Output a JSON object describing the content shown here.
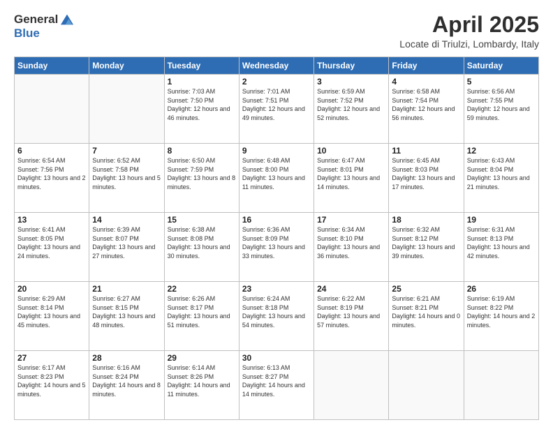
{
  "logo": {
    "general": "General",
    "blue": "Blue"
  },
  "title": "April 2025",
  "location": "Locate di Triulzi, Lombardy, Italy",
  "days_of_week": [
    "Sunday",
    "Monday",
    "Tuesday",
    "Wednesday",
    "Thursday",
    "Friday",
    "Saturday"
  ],
  "weeks": [
    [
      {
        "day": "",
        "sunrise": "",
        "sunset": "",
        "daylight": ""
      },
      {
        "day": "",
        "sunrise": "",
        "sunset": "",
        "daylight": ""
      },
      {
        "day": "1",
        "sunrise": "Sunrise: 7:03 AM",
        "sunset": "Sunset: 7:50 PM",
        "daylight": "Daylight: 12 hours and 46 minutes."
      },
      {
        "day": "2",
        "sunrise": "Sunrise: 7:01 AM",
        "sunset": "Sunset: 7:51 PM",
        "daylight": "Daylight: 12 hours and 49 minutes."
      },
      {
        "day": "3",
        "sunrise": "Sunrise: 6:59 AM",
        "sunset": "Sunset: 7:52 PM",
        "daylight": "Daylight: 12 hours and 52 minutes."
      },
      {
        "day": "4",
        "sunrise": "Sunrise: 6:58 AM",
        "sunset": "Sunset: 7:54 PM",
        "daylight": "Daylight: 12 hours and 56 minutes."
      },
      {
        "day": "5",
        "sunrise": "Sunrise: 6:56 AM",
        "sunset": "Sunset: 7:55 PM",
        "daylight": "Daylight: 12 hours and 59 minutes."
      }
    ],
    [
      {
        "day": "6",
        "sunrise": "Sunrise: 6:54 AM",
        "sunset": "Sunset: 7:56 PM",
        "daylight": "Daylight: 13 hours and 2 minutes."
      },
      {
        "day": "7",
        "sunrise": "Sunrise: 6:52 AM",
        "sunset": "Sunset: 7:58 PM",
        "daylight": "Daylight: 13 hours and 5 minutes."
      },
      {
        "day": "8",
        "sunrise": "Sunrise: 6:50 AM",
        "sunset": "Sunset: 7:59 PM",
        "daylight": "Daylight: 13 hours and 8 minutes."
      },
      {
        "day": "9",
        "sunrise": "Sunrise: 6:48 AM",
        "sunset": "Sunset: 8:00 PM",
        "daylight": "Daylight: 13 hours and 11 minutes."
      },
      {
        "day": "10",
        "sunrise": "Sunrise: 6:47 AM",
        "sunset": "Sunset: 8:01 PM",
        "daylight": "Daylight: 13 hours and 14 minutes."
      },
      {
        "day": "11",
        "sunrise": "Sunrise: 6:45 AM",
        "sunset": "Sunset: 8:03 PM",
        "daylight": "Daylight: 13 hours and 17 minutes."
      },
      {
        "day": "12",
        "sunrise": "Sunrise: 6:43 AM",
        "sunset": "Sunset: 8:04 PM",
        "daylight": "Daylight: 13 hours and 21 minutes."
      }
    ],
    [
      {
        "day": "13",
        "sunrise": "Sunrise: 6:41 AM",
        "sunset": "Sunset: 8:05 PM",
        "daylight": "Daylight: 13 hours and 24 minutes."
      },
      {
        "day": "14",
        "sunrise": "Sunrise: 6:39 AM",
        "sunset": "Sunset: 8:07 PM",
        "daylight": "Daylight: 13 hours and 27 minutes."
      },
      {
        "day": "15",
        "sunrise": "Sunrise: 6:38 AM",
        "sunset": "Sunset: 8:08 PM",
        "daylight": "Daylight: 13 hours and 30 minutes."
      },
      {
        "day": "16",
        "sunrise": "Sunrise: 6:36 AM",
        "sunset": "Sunset: 8:09 PM",
        "daylight": "Daylight: 13 hours and 33 minutes."
      },
      {
        "day": "17",
        "sunrise": "Sunrise: 6:34 AM",
        "sunset": "Sunset: 8:10 PM",
        "daylight": "Daylight: 13 hours and 36 minutes."
      },
      {
        "day": "18",
        "sunrise": "Sunrise: 6:32 AM",
        "sunset": "Sunset: 8:12 PM",
        "daylight": "Daylight: 13 hours and 39 minutes."
      },
      {
        "day": "19",
        "sunrise": "Sunrise: 6:31 AM",
        "sunset": "Sunset: 8:13 PM",
        "daylight": "Daylight: 13 hours and 42 minutes."
      }
    ],
    [
      {
        "day": "20",
        "sunrise": "Sunrise: 6:29 AM",
        "sunset": "Sunset: 8:14 PM",
        "daylight": "Daylight: 13 hours and 45 minutes."
      },
      {
        "day": "21",
        "sunrise": "Sunrise: 6:27 AM",
        "sunset": "Sunset: 8:15 PM",
        "daylight": "Daylight: 13 hours and 48 minutes."
      },
      {
        "day": "22",
        "sunrise": "Sunrise: 6:26 AM",
        "sunset": "Sunset: 8:17 PM",
        "daylight": "Daylight: 13 hours and 51 minutes."
      },
      {
        "day": "23",
        "sunrise": "Sunrise: 6:24 AM",
        "sunset": "Sunset: 8:18 PM",
        "daylight": "Daylight: 13 hours and 54 minutes."
      },
      {
        "day": "24",
        "sunrise": "Sunrise: 6:22 AM",
        "sunset": "Sunset: 8:19 PM",
        "daylight": "Daylight: 13 hours and 57 minutes."
      },
      {
        "day": "25",
        "sunrise": "Sunrise: 6:21 AM",
        "sunset": "Sunset: 8:21 PM",
        "daylight": "Daylight: 14 hours and 0 minutes."
      },
      {
        "day": "26",
        "sunrise": "Sunrise: 6:19 AM",
        "sunset": "Sunset: 8:22 PM",
        "daylight": "Daylight: 14 hours and 2 minutes."
      }
    ],
    [
      {
        "day": "27",
        "sunrise": "Sunrise: 6:17 AM",
        "sunset": "Sunset: 8:23 PM",
        "daylight": "Daylight: 14 hours and 5 minutes."
      },
      {
        "day": "28",
        "sunrise": "Sunrise: 6:16 AM",
        "sunset": "Sunset: 8:24 PM",
        "daylight": "Daylight: 14 hours and 8 minutes."
      },
      {
        "day": "29",
        "sunrise": "Sunrise: 6:14 AM",
        "sunset": "Sunset: 8:26 PM",
        "daylight": "Daylight: 14 hours and 11 minutes."
      },
      {
        "day": "30",
        "sunrise": "Sunrise: 6:13 AM",
        "sunset": "Sunset: 8:27 PM",
        "daylight": "Daylight: 14 hours and 14 minutes."
      },
      {
        "day": "",
        "sunrise": "",
        "sunset": "",
        "daylight": ""
      },
      {
        "day": "",
        "sunrise": "",
        "sunset": "",
        "daylight": ""
      },
      {
        "day": "",
        "sunrise": "",
        "sunset": "",
        "daylight": ""
      }
    ]
  ]
}
